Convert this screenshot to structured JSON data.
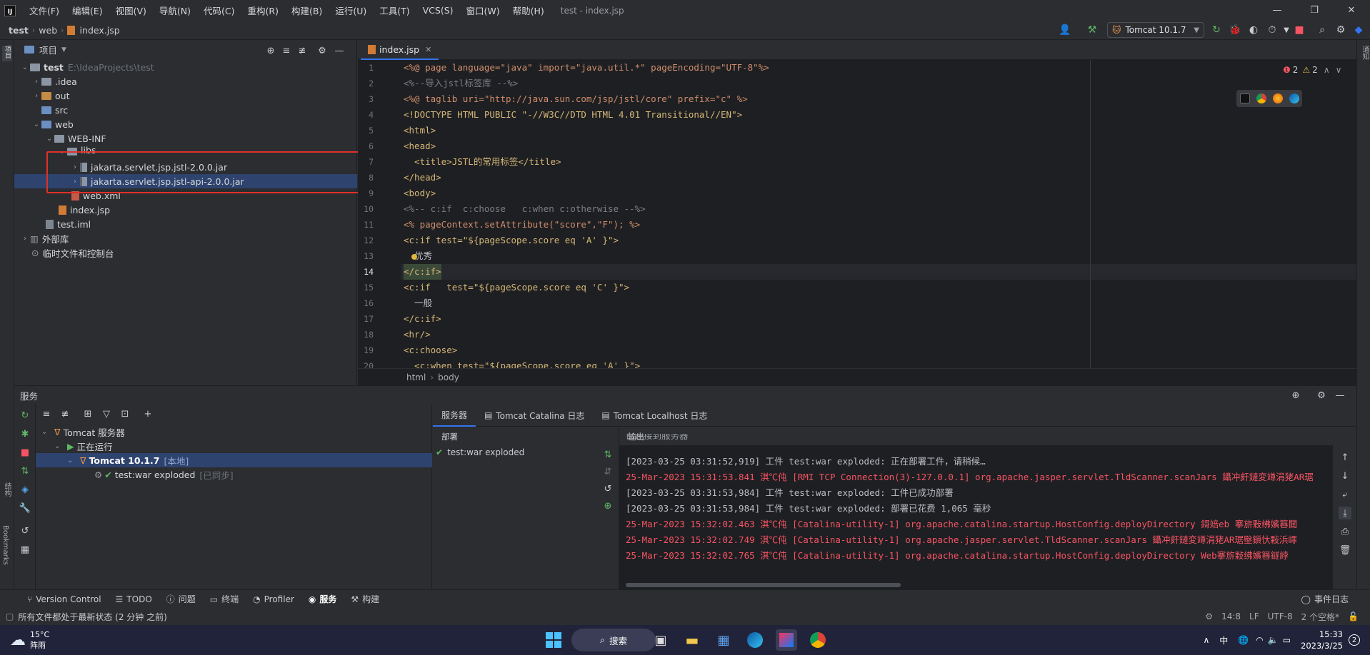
{
  "menubar": {
    "items": [
      "文件(F)",
      "编辑(E)",
      "视图(V)",
      "导航(N)",
      "代码(C)",
      "重构(R)",
      "构建(B)",
      "运行(U)",
      "工具(T)",
      "VCS(S)",
      "窗口(W)",
      "帮助(H)"
    ],
    "title": "test - index.jsp"
  },
  "navbar": {
    "crumbs": [
      "test",
      "web",
      "index.jsp"
    ]
  },
  "toolbar": {
    "run_config": "Tomcat 10.1.7"
  },
  "project": {
    "header": "项目",
    "root_name": "test",
    "root_path": "E:\\IdeaProjects\\test",
    "items": [
      ".idea",
      "out",
      "src",
      "web",
      "WEB-INF",
      "libs",
      "jakarta.servlet.jsp.jstl-2.0.0.jar",
      "jakarta.servlet.jsp.jstl-api-2.0.0.jar",
      "web.xml",
      "index.jsp",
      "test.iml",
      "外部库",
      "临时文件和控制台"
    ]
  },
  "editor": {
    "tab": "index.jsp",
    "inspections": {
      "errors": "2",
      "warnings": "2"
    },
    "crumbs": [
      "html",
      "body"
    ],
    "line_numbers": [
      "1",
      "2",
      "3",
      "4",
      "5",
      "6",
      "7",
      "8",
      "9",
      "10",
      "11",
      "12",
      "13",
      "14",
      "15",
      "16",
      "17",
      "18",
      "19",
      "20"
    ],
    "lines": [
      "<%@ page language=\"java\" import=\"java.util.*\" pageEncoding=\"UTF-8\"%>",
      "<%--导入jstl标签库 --%>",
      "<%@ taglib uri=\"http://java.sun.com/jsp/jstl/core\" prefix=\"c\" %>",
      "<!DOCTYPE HTML PUBLIC \"-//W3C//DTD HTML 4.01 Transitional//EN\">",
      "<html>",
      "<head>",
      "  <title>JSTL的常用标签</title>",
      "</head>",
      "<body>",
      "<%-- c:if  c:choose   c:when c:otherwise --%>",
      "<% pageContext.setAttribute(\"score\",\"F\"); %>",
      "<c:if test=\"${pageScope.score eq 'A' }\">",
      "  优秀",
      "</c:if>",
      "<c:if   test=\"${pageScope.score eq 'C' }\">",
      "  一般",
      "</c:if>",
      "<hr/>",
      "<c:choose>",
      "  <c:when test=\"${pageScope.score eq 'A' }\">"
    ]
  },
  "services": {
    "header": "服务",
    "tree": [
      "Tomcat 服务器",
      "正在运行",
      "Tomcat 10.1.7",
      "[本地]",
      "test:war exploded",
      "[已同步]"
    ],
    "tabs": [
      "服务器",
      "Tomcat Catalina 日志",
      "Tomcat Localhost 日志"
    ],
    "deploy_header": "部署",
    "output_header": "输出",
    "deploy_item": "test:war exploded",
    "log_partial": "已连接到服务器",
    "log_lines": [
      "[2023-03-25 03:31:52,919] 工件 test:war exploded: 正在部署工件，请稍候…",
      "25-Mar-2023 15:31:53.841 淇℃伅 [RMI TCP Connection(3)-127.0.0.1] org.apache.jasper.servlet.TldScanner.scanJars 鑷冲皯鏈変竴涓狫AR琚",
      "[2023-03-25 03:31:53,984] 工件 test:war exploded: 工件已成功部署",
      "[2023-03-25 03:31:53,984] 工件 test:war exploded: 部署已花费 1,065 毫秒",
      "25-Mar-2023 15:32:02.463 淇℃伅 [Catalina-utility-1] org.apache.catalina.startup.HostConfig.deployDirectory 鎶婄eb 搴旂敤绋嬪簭閮",
      "25-Mar-2023 15:32:02.749 淇℃伅 [Catalina-utility-1] org.apache.jasper.servlet.TldScanner.scanJars 鑷冲皯鏈変竴涓狫AR琚壂鎻忕敤浜嶵",
      "25-Mar-2023 15:32:02.765 淇℃伅 [Catalina-utility-1] org.apache.catalina.startup.HostConfig.deployDirectory Web搴旂敤绋嬪簭鐩綍"
    ]
  },
  "bottom_tabs": [
    "Version Control",
    "TODO",
    "问题",
    "终端",
    "Profiler",
    "服务",
    "构建"
  ],
  "statusbar": {
    "message": "所有文件都处于最新状态 (2 分钟 之前)",
    "position": "14:8",
    "line_sep": "LF",
    "encoding": "UTF-8",
    "indent": "2 个空格*",
    "event_log": "事件日志"
  },
  "taskbar": {
    "temp": "15°C",
    "weather": "阵雨",
    "search": "搜索",
    "ime": "中",
    "time": "15:33",
    "date": "2023/3/25",
    "badge": "2"
  },
  "colors": {
    "accent": "#3574f0",
    "error": "#f75464",
    "highlight_box": "#e0302a"
  }
}
